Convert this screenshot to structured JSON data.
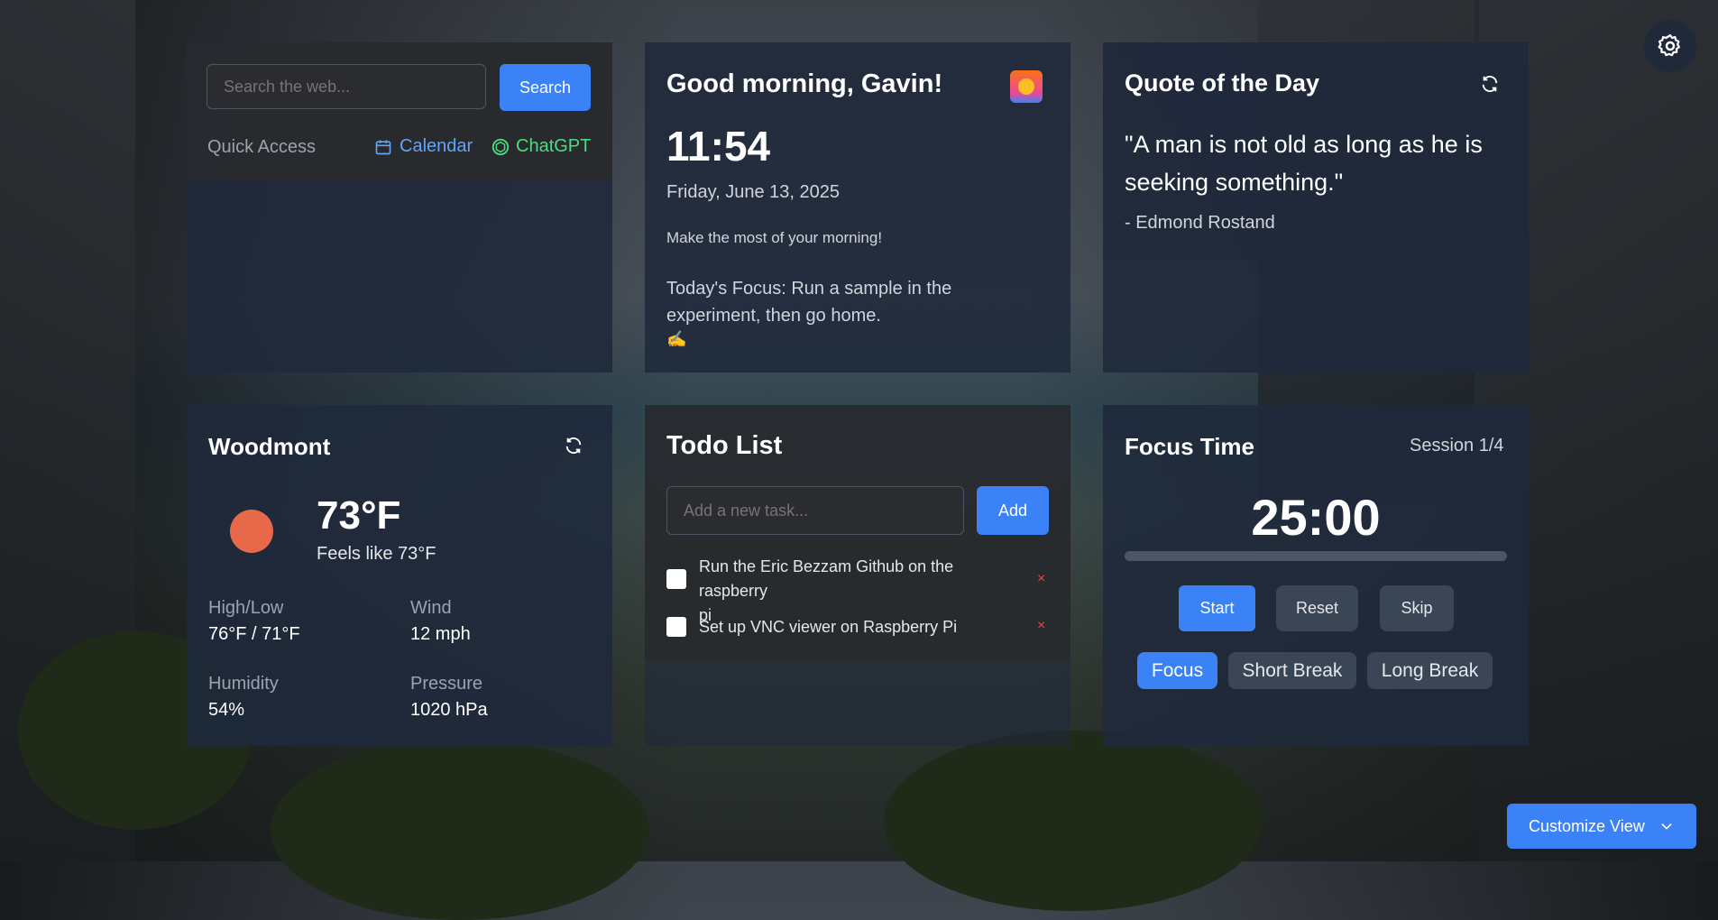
{
  "search": {
    "placeholder": "Search the web...",
    "button": "Search",
    "quick_access_label": "Quick Access",
    "links": [
      {
        "label": "Calendar",
        "icon": "calendar-icon",
        "color": "#60a5fa"
      },
      {
        "label": "ChatGPT",
        "icon": "chatgpt-icon",
        "color": "#4ade80"
      }
    ]
  },
  "greeting": {
    "title": "Good morning, Gavin!",
    "icon": "sunrise-icon",
    "time": "11:54",
    "date": "Friday, June 13, 2025",
    "message": "Make the most of your morning!",
    "focus_line1": "Today's Focus: Run a sample in the",
    "focus_line2": "experiment, then go home.",
    "focus_emoji": "✍️"
  },
  "quote": {
    "title": "Quote of the Day",
    "line1": "\"A man is not old as long as he is",
    "line2": "seeking something.\"",
    "author": "- Edmond Rostand"
  },
  "weather": {
    "location": "Woodmont",
    "temp": "73°F",
    "feels_like": "Feels like 73°F",
    "high_low_label": "High/Low",
    "high_low": "76°F / 71°F",
    "wind_label": "Wind",
    "wind": "12 mph",
    "humidity_label": "Humidity",
    "humidity": "54%",
    "pressure_label": "Pressure",
    "pressure": "1020 hPa",
    "sun_color": "#e8694a"
  },
  "todo": {
    "title": "Todo List",
    "placeholder": "Add a new task...",
    "add_button": "Add",
    "items": [
      {
        "line1": "Run the Eric Bezzam Github on the raspberry",
        "line2": "pi",
        "delete": "×"
      },
      {
        "line1": "Set up VNC viewer on Raspberry Pi",
        "line2": "",
        "delete": "×"
      }
    ]
  },
  "focus": {
    "title": "Focus Time",
    "session": "Session 1/4",
    "timer": "25:00",
    "progress": 0,
    "start": "Start",
    "reset": "Reset",
    "skip": "Skip",
    "modes": [
      "Focus",
      "Short Break",
      "Long Break"
    ],
    "active_mode": "Focus"
  },
  "customize": {
    "label": "Customize View"
  },
  "colors": {
    "accent": "#3b82f6",
    "card": "#1f293b"
  }
}
